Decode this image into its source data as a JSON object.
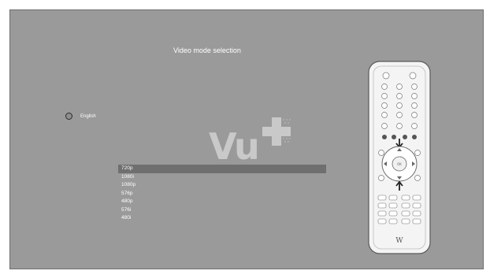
{
  "header": {
    "title": "Video mode selection"
  },
  "language": {
    "label": "English",
    "selected": false
  },
  "logo": {
    "text": "Vu",
    "tagline": ""
  },
  "resolutions": {
    "items": [
      {
        "label": "720p",
        "selected": true
      },
      {
        "label": "1080i",
        "selected": false
      },
      {
        "label": "1080p",
        "selected": false
      },
      {
        "label": "576p",
        "selected": false
      },
      {
        "label": "480p",
        "selected": false
      },
      {
        "label": "576i",
        "selected": false
      },
      {
        "label": "480i",
        "selected": false
      }
    ]
  },
  "remote": {
    "brand_mark": "W"
  },
  "colors": {
    "screen_bg": "#9a9a9a",
    "selection": "#6f6f6f",
    "text": "#ffffff"
  }
}
